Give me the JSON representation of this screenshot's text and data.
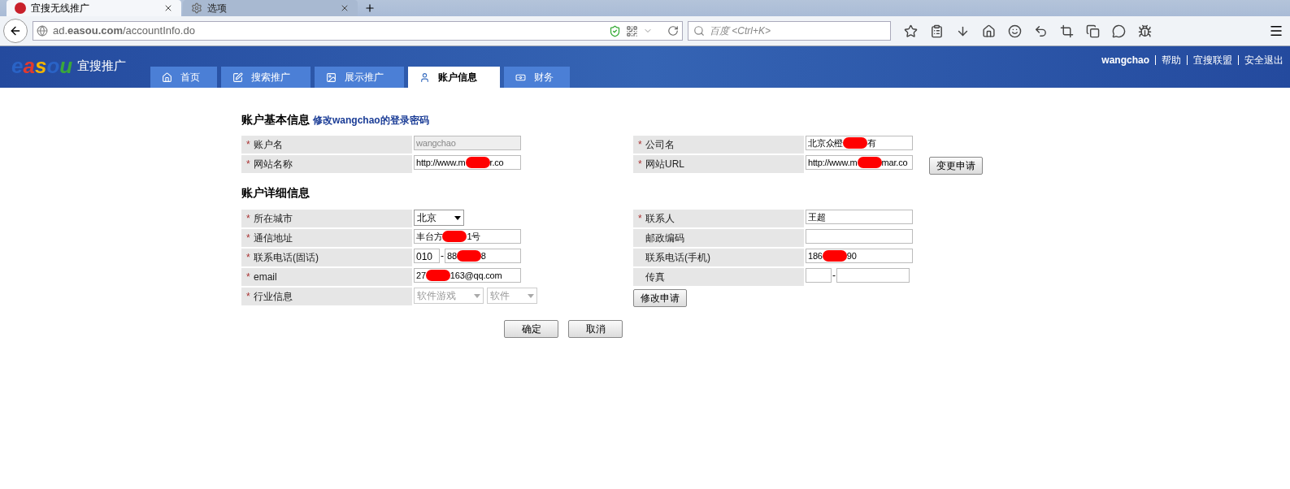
{
  "browser": {
    "tabs": [
      {
        "title": "宜搜无线推广",
        "selected": true
      },
      {
        "title": "选项",
        "selected": false
      }
    ],
    "url": "ad.**easou.com**/accountInfo.do",
    "search": {
      "placeholder": "百度 <Ctrl+K>"
    }
  },
  "header": {
    "logo": "easou",
    "brand": "宜搜推广",
    "nav": [
      {
        "label": "首页",
        "kind": "home",
        "selected": false
      },
      {
        "label": "搜索推广",
        "kind": "edit",
        "selected": false
      },
      {
        "label": "展示推广",
        "kind": "image",
        "selected": false
      },
      {
        "label": "账户信息",
        "kind": "user",
        "selected": true
      },
      {
        "label": "财务",
        "kind": "money",
        "selected": false
      }
    ],
    "user_links": [
      "wangchao",
      "帮助",
      "宜搜联盟",
      "安全退出"
    ]
  },
  "basic": {
    "title": "账户基本信息",
    "link": "修改wangchao的登录密码",
    "left": [
      {
        "label": "账户名",
        "required": true,
        "kind": "text",
        "parts": [
          "wangchao"
        ],
        "disabled": true
      },
      {
        "label": "网站名称",
        "required": true,
        "kind": "text",
        "parts": [
          "http://www.m",
          "r.co"
        ],
        "disabled": false
      }
    ],
    "right": [
      {
        "label": "公司名",
        "required": true,
        "kind": "text",
        "parts": [
          "北京众橙",
          "有"
        ],
        "disabled": false
      },
      {
        "label": "网站URL",
        "required": true,
        "kind": "text",
        "parts": [
          "http://www.m",
          "mar.co"
        ],
        "disabled": false
      }
    ],
    "button": "变更申请"
  },
  "detail": {
    "title": "账户详细信息",
    "left": [
      {
        "label": "所在城市",
        "required": true,
        "kind": "select",
        "values": [
          "北京"
        ],
        "disabled": false
      },
      {
        "label": "通信地址",
        "required": true,
        "kind": "text",
        "parts": [
          "丰台方",
          "1号"
        ],
        "disabled": false
      },
      {
        "label": "联系电话(固话)",
        "required": true,
        "kind": "phone",
        "area": "010",
        "parts": [
          "88",
          "8"
        ]
      },
      {
        "label": "email",
        "required": true,
        "kind": "text",
        "parts": [
          "27",
          "163@qq.com"
        ],
        "disabled": false
      },
      {
        "label": "行业信息",
        "required": true,
        "kind": "select",
        "values": [
          "软件游戏",
          "软件"
        ],
        "disabled": true
      }
    ],
    "right": [
      {
        "label": "联系人",
        "required": true,
        "kind": "text",
        "parts": [
          "王超"
        ],
        "disabled": false
      },
      {
        "label": "邮政编码",
        "required": false,
        "kind": "text",
        "disabled": false
      },
      {
        "label": "联系电话(手机)",
        "required": false,
        "kind": "text",
        "parts": [
          "186",
          "90"
        ],
        "disabled": false
      },
      {
        "label": "传真",
        "required": false,
        "kind": "phone"
      }
    ],
    "button": "修改申请"
  },
  "actions": [
    "确定",
    "取消"
  ],
  "required_mark": "*",
  "phone_separator": "-"
}
